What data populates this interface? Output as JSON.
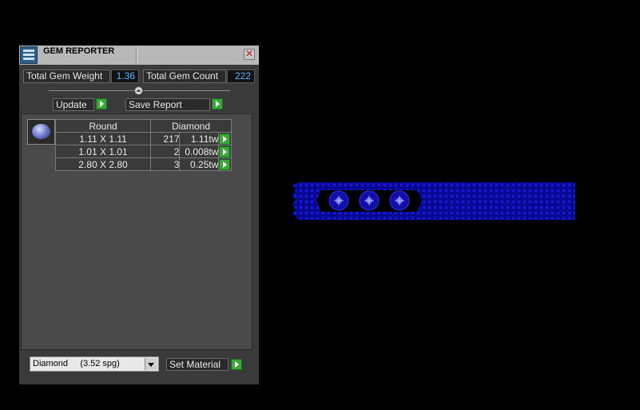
{
  "window": {
    "title": "GEM REPORTER"
  },
  "totals": {
    "weight_label": "Total Gem Weight",
    "weight_value": "1.36",
    "count_label": "Total Gem Count",
    "count_value": "222"
  },
  "actions": {
    "update_label": "Update",
    "save_label": "Save Report"
  },
  "table": {
    "headers": {
      "shape": "Round",
      "material": "Diamond"
    },
    "rows": [
      {
        "size": "1.11 X 1.11",
        "qty": "217",
        "weight": "1.11tw"
      },
      {
        "size": "1.01 X 1.01",
        "qty": "2",
        "weight": "0.008tw"
      },
      {
        "size": "2.80 X 2.80",
        "qty": "3",
        "weight": "0.25tw"
      }
    ]
  },
  "material": {
    "selected": "Diamond     (3.52 spg)",
    "set_label": "Set Material"
  },
  "colors": {
    "accent_green": "#3aa83a",
    "value_blue": "#5ab4ff",
    "gem_blue": "#1010c8"
  }
}
